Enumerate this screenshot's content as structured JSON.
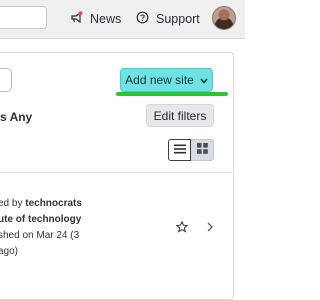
{
  "topbar": {
    "news_label": "News",
    "support_label": "Support"
  },
  "toolbar": {
    "add_site_label": "Add new site",
    "any_label": "s Any",
    "edit_filters_label": "Edit filters"
  },
  "site": {
    "line1_prefix": "ed by ",
    "line1_owner": "technocrats",
    "line2": "ute of technology",
    "line3": "shed on Mar 24 (3",
    "line4": "ago)"
  },
  "colors": {
    "accent_button": "#6fe3e3",
    "highlight_underline": "#2fc42f"
  }
}
